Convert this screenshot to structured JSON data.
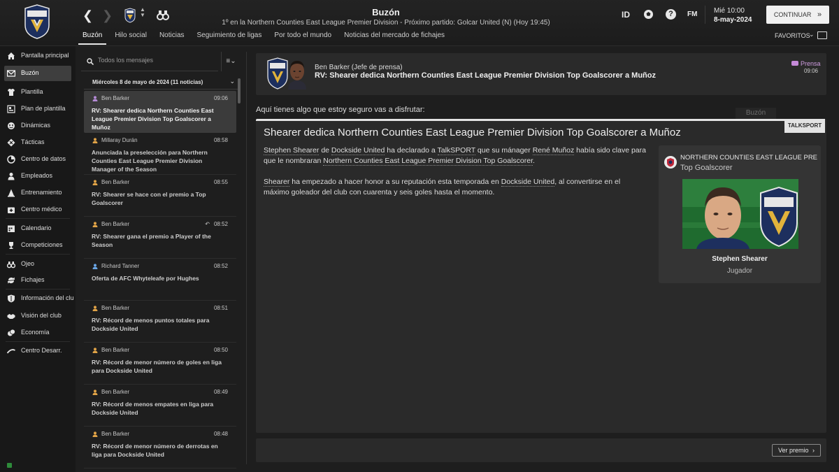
{
  "header": {
    "title": "Buzón",
    "subtitle": "1º en la Northern Counties East League Premier Division - Próximo partido: Golcar United (N) (Hoy 19:45)",
    "back_icon": "arrow-left-icon",
    "forward_icon": "arrow-right-icon",
    "scout_icon": "binoculars-icon",
    "tabs": [
      {
        "label": "Buzón"
      },
      {
        "label": "Hilo social"
      },
      {
        "label": "Noticias"
      },
      {
        "label": "Seguimiento de ligas"
      },
      {
        "label": "Por todo el mundo"
      },
      {
        "label": "Noticias del mercado de fichajes"
      }
    ],
    "id_label": "ID",
    "fm_label": "FM",
    "help_label": "?",
    "date_day": "Mié 10:00",
    "date": "8-may-2024",
    "continue_label": "CONTINUAR",
    "continue_icon": "»",
    "favorites_label": "FAVORITOS",
    "favorites_chevron": "⌄"
  },
  "sidebar": {
    "items": [
      {
        "label": "Pantalla principal",
        "icon": "home-icon"
      },
      {
        "label": "Buzón",
        "icon": "mail-icon"
      },
      {
        "label": "Plantilla",
        "icon": "shirt-icon"
      },
      {
        "label": "Plan de plantilla",
        "icon": "squad-plan-icon"
      },
      {
        "label": "Dinámicas",
        "icon": "dynamics-icon"
      },
      {
        "label": "Tácticas",
        "icon": "tactics-icon"
      },
      {
        "label": "Centro de datos",
        "icon": "data-icon"
      },
      {
        "label": "Empleados",
        "icon": "staff-icon"
      },
      {
        "label": "Entrenamiento",
        "icon": "training-cone-icon"
      },
      {
        "label": "Centro médico",
        "icon": "medical-icon"
      },
      {
        "label": "Calendario",
        "icon": "calendar-icon"
      },
      {
        "label": "Competiciones",
        "icon": "trophy-icon"
      },
      {
        "label": "Ojeo",
        "icon": "binoculars-icon"
      },
      {
        "label": "Fichajes",
        "icon": "transfers-icon"
      },
      {
        "label": "Información del club",
        "icon": "shield-icon"
      },
      {
        "label": "Visión del club",
        "icon": "handshake-icon"
      },
      {
        "label": "Economía",
        "icon": "finance-icon"
      },
      {
        "label": "Centro Desarr.",
        "icon": "development-icon"
      }
    ]
  },
  "inbox": {
    "search_placeholder": "Todos los mensajes",
    "filter_icon": "≡⌄",
    "day_header": "Miércoles 8 de mayo de 2024 (11 noticias)",
    "messages": [
      {
        "sender": "Ben Barker",
        "time": "09:06",
        "subject": "RV: Shearer dedica Northern Counties East League Premier Division Top Goalscorer a Muñoz",
        "icon_color": "#b58bd6"
      },
      {
        "sender": "Millaray Durán",
        "time": "08:58",
        "subject": "Anunciada la preselección para Northern Counties East League Premier Division Manager of the Season",
        "icon_color": "#e0a347"
      },
      {
        "sender": "Ben Barker",
        "time": "08:55",
        "subject": "RV: Shearer se hace con el premio a Top Goalscorer",
        "icon_color": "#e0a347"
      },
      {
        "sender": "Ben Barker",
        "time": "08:52",
        "subject": "RV: Shearer gana el premio a Player of the Season",
        "icon_color": "#e0a347",
        "replied": true
      },
      {
        "sender": "Richard Tanner",
        "time": "08:52",
        "subject": "Oferta de AFC Whyteleafe por Hughes",
        "icon_color": "#6aa6e6"
      },
      {
        "sender": "Ben Barker",
        "time": "08:51",
        "subject": "RV: Récord de menos puntos totales para Dockside United",
        "icon_color": "#e0a347"
      },
      {
        "sender": "Ben Barker",
        "time": "08:50",
        "subject": "RV: Récord de menor número de goles en liga para Dockside United",
        "icon_color": "#e0a347"
      },
      {
        "sender": "Ben Barker",
        "time": "08:49",
        "subject": "RV: Récord de menos empates en liga para Dockside United",
        "icon_color": "#e0a347"
      },
      {
        "sender": "Ben Barker",
        "time": "08:48",
        "subject": "RV: Récord de menor número de derrotas en liga para Dockside United",
        "icon_color": "#e0a347"
      }
    ]
  },
  "detail": {
    "from": "Ben Barker  (Jefe de prensa)",
    "subject": "RV: Shearer dedica Northern Counties East League Premier Division Top Goalscorer a Muñoz",
    "type": "Prensa",
    "time": "09:06",
    "intro": "Aquí tienes algo que estoy seguro vas a disfrutar:",
    "watermark": "Buzón",
    "article": {
      "source": "TALKSPORT",
      "title": "Shearer dedica Northern Counties East League Premier Division Top Goalscorer a Muñoz",
      "p1": {
        "a": "Stephen Shearer",
        "b": " de ",
        "c": "Dockside United",
        "d": " ha declarado a ",
        "e": "TalkSPORT",
        "f": " que su mánager ",
        "g": "René Muñoz",
        "h": " había sido clave para que le nombraran ",
        "i": "Northern Counties East League Premier Division Top Goalscorer",
        "j": "."
      },
      "p2": {
        "a": "Shearer",
        "b": " ha empezado a hacer honor a su reputación esta temporada en ",
        "c": "Dockside United",
        "d": ", al convertirse en el máximo goleador del club con cuarenta y seis goles hasta el momento."
      }
    },
    "award": {
      "competition": "NORTHERN COUNTIES EAST LEAGUE PREMIER...",
      "name": "Top Goalscorer",
      "player": "Stephen Shearer",
      "role": "Jugador"
    },
    "footer_button": "Ver premio",
    "footer_icon": "›"
  },
  "colors": {
    "background": "#1e1e1e",
    "panel": "#2a2a2a",
    "accent_press": "#cf9de0",
    "pitch_green": "#1f6b2f",
    "crest_navy": "#1d2f5e",
    "crest_gold": "#e2b33b"
  }
}
